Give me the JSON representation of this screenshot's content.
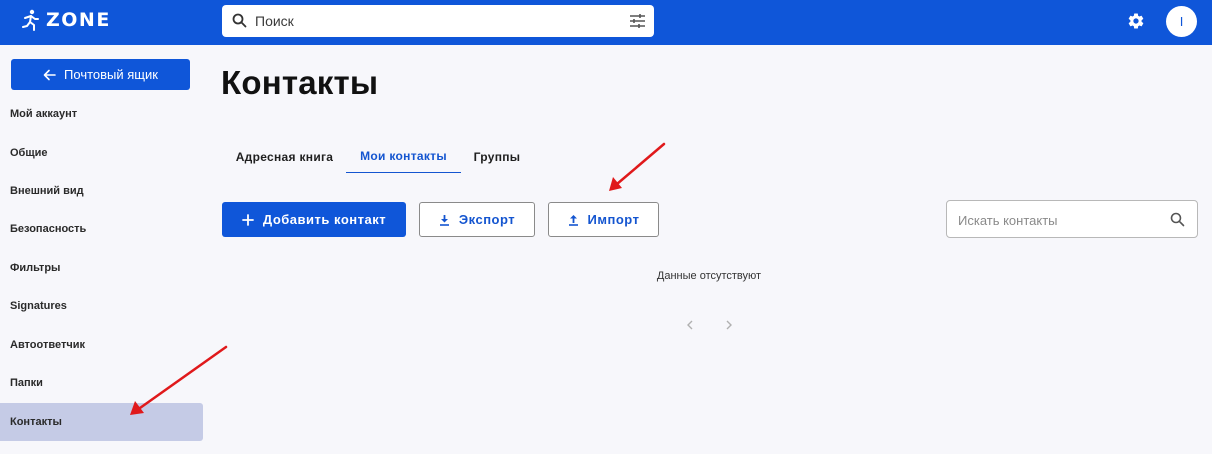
{
  "header": {
    "logo_text": "ZONE",
    "search_placeholder": "Поиск"
  },
  "avatar": {
    "initial": "I"
  },
  "sidebar": {
    "mailbox_button": "Почтовый ящик",
    "items": [
      {
        "label": "Мой аккаунт"
      },
      {
        "label": "Общие"
      },
      {
        "label": "Внешний вид"
      },
      {
        "label": "Безопасность"
      },
      {
        "label": "Фильтры"
      },
      {
        "label": "Signatures"
      },
      {
        "label": "Автоответчик"
      },
      {
        "label": "Папки"
      },
      {
        "label": "Контакты"
      }
    ],
    "active_item": "Контакты"
  },
  "main": {
    "title": "Контакты",
    "tabs": [
      {
        "label": "Адресная книга"
      },
      {
        "label": "Мои контакты"
      },
      {
        "label": "Группы"
      }
    ],
    "active_tab": "Мои контакты",
    "toolbar": {
      "add_label": "Добавить контакт",
      "export_label": "Экспорт",
      "import_label": "Импорт"
    },
    "contact_search_placeholder": "Искать контакты",
    "empty_message": "Данные отсутствуют"
  },
  "colors": {
    "brand": "#0f56d9",
    "active_sidebar": "#c5cbe6",
    "annotation_arrow": "#e0191b"
  }
}
